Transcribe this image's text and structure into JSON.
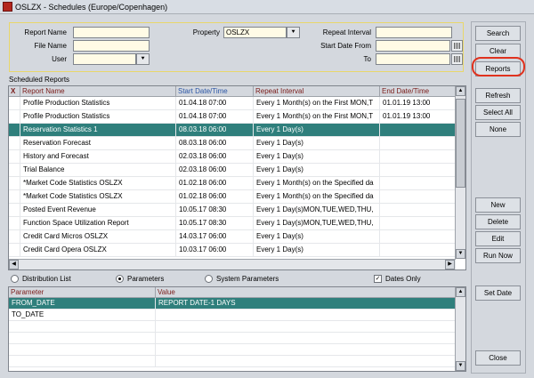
{
  "window": {
    "title": "OSLZX - Schedules (Europe/Copenhagen)"
  },
  "search": {
    "report_name_label": "Report Name",
    "file_name_label": "File Name",
    "user_label": "User",
    "property_label": "Property",
    "property_value": "OSLZX",
    "repeat_interval_label": "Repeat Interval",
    "start_date_from_label": "Start Date From",
    "to_label": "To"
  },
  "buttons": {
    "search": "Search",
    "clear": "Clear",
    "reports": "Reports",
    "refresh": "Refresh",
    "select_all": "Select All",
    "none": "None",
    "new": "New",
    "delete": "Delete",
    "edit": "Edit",
    "run_now": "Run Now",
    "set_date": "Set Date",
    "close": "Close"
  },
  "scheduled": {
    "title": "Scheduled Reports",
    "columns": [
      "X",
      "Report Name",
      "Start Date/Time",
      "Repeat Interval",
      "End Date/Time"
    ],
    "rows": [
      {
        "name": "Profile Production Statistics",
        "start": "01.04.18 07:00",
        "repeat": "Every 1 Month(s) on the First MON,T",
        "end": "01.01.19 13:00"
      },
      {
        "name": "Profile Production Statistics",
        "start": "01.04.18 07:00",
        "repeat": "Every 1 Month(s) on the First MON,T",
        "end": "01.01.19 13:00"
      },
      {
        "name": "Reservation Statistics 1",
        "start": "08.03.18 06:00",
        "repeat": "Every 1 Day(s)",
        "end": ""
      },
      {
        "name": "Reservation Forecast",
        "start": "08.03.18 06:00",
        "repeat": "Every 1 Day(s)",
        "end": ""
      },
      {
        "name": "History and Forecast",
        "start": "02.03.18 06:00",
        "repeat": "Every 1 Day(s)",
        "end": ""
      },
      {
        "name": "Trial Balance",
        "start": "02.03.18 06:00",
        "repeat": "Every 1 Day(s)",
        "end": ""
      },
      {
        "name": "*Market Code Statistics OSLZX",
        "start": "01.02.18 06:00",
        "repeat": "Every 1 Month(s) on the Specified da",
        "end": ""
      },
      {
        "name": "*Market Code Statistics OSLZX",
        "start": "01.02.18 06:00",
        "repeat": "Every 1 Month(s) on the Specified da",
        "end": ""
      },
      {
        "name": "Posted Event Revenue",
        "start": "10.05.17 08:30",
        "repeat": "Every 1 Day(s)MON,TUE,WED,THU,",
        "end": ""
      },
      {
        "name": "Function Space Utilization Report",
        "start": "10.05.17 08:30",
        "repeat": "Every 1 Day(s)MON,TUE,WED,THU,",
        "end": ""
      },
      {
        "name": "Credit Card Micros OSLZX",
        "start": "14.03.17 06:00",
        "repeat": "Every 1 Day(s)",
        "end": ""
      },
      {
        "name": "Credit Card Opera OSLZX",
        "start": "10.03.17 06:00",
        "repeat": "Every 1 Day(s)",
        "end": ""
      }
    ]
  },
  "options": {
    "distribution_list": "Distribution List",
    "parameters": "Parameters",
    "system_parameters": "System Parameters",
    "dates_only": "Dates Only"
  },
  "params": {
    "columns": [
      "Parameter",
      "Value"
    ],
    "rows": [
      {
        "parameter": "FROM_DATE",
        "value": "REPORT DATE-1 DAYS"
      },
      {
        "parameter": "TO_DATE",
        "value": ""
      }
    ]
  },
  "colors": {
    "selection": "#2f7f7c",
    "highlight": "#e0321e",
    "panel_border": "#e9d76a"
  }
}
